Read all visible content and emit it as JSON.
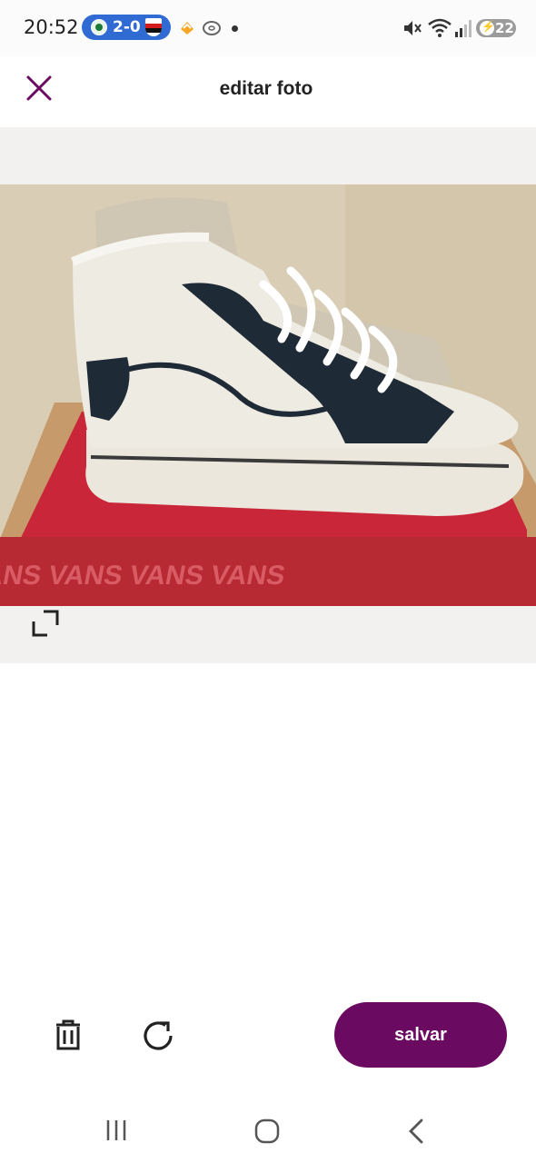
{
  "status_bar": {
    "time": "20:52",
    "score": "2-0",
    "battery": "22",
    "notification_icons": [
      "clock-icon",
      "palmeiras-crest-icon",
      "sao-paulo-crest-icon",
      "mercado-livre-icon",
      "bagel-icon",
      "notification-dot-icon"
    ],
    "system_icons": [
      "mute-icon",
      "wifi-icon",
      "signal-icon",
      "battery-charging-icon"
    ]
  },
  "header": {
    "title": "editar foto",
    "close_icon": "close-icon"
  },
  "editor": {
    "photo_alt": "foto do tênis",
    "crop_icon": "crop-expand-icon"
  },
  "actions": {
    "delete_icon": "trash-icon",
    "rotate_icon": "rotate-icon",
    "save_label": "salvar"
  },
  "nav": {
    "icons": [
      "recents-icon",
      "home-icon",
      "back-icon"
    ]
  },
  "colors": {
    "accent": "#6a0a60",
    "editor_background": "#f2f1ef",
    "battery": "#9b9b9b",
    "score_pill": "#2f6bd3"
  }
}
